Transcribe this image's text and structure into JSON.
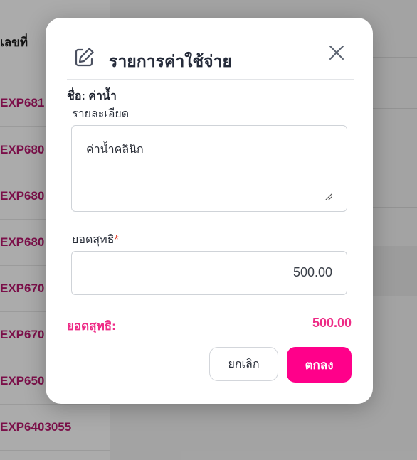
{
  "background": {
    "column_header": "เลขที่",
    "rows": [
      "EXP681",
      "EXP680",
      "EXP680",
      "EXP680",
      "EXP670",
      "EXP670",
      "EXP650",
      "EXP6403055"
    ]
  },
  "modal": {
    "title": "รายการค่าใช้จ่าย",
    "name_line": "ชื่อ: ค่าน้ำ",
    "detail_label": "รายละเอียด",
    "detail_value": "ค่าน้ำคลินิก",
    "net_label": "ยอดสุทธิ",
    "required_mark": "*",
    "net_value": "500.00",
    "summary_label": "ยอดสุทธิ:",
    "summary_value": "500.00",
    "cancel_label": "ยกเลิก",
    "ok_label": "ตกลง",
    "icons": {
      "header": "edit-icon",
      "close": "close-icon",
      "resize": "resize-handle-icon"
    }
  },
  "colors": {
    "accent": "#ff008a",
    "summary": "#ee2a86",
    "required": "#e0321c",
    "row_id": "#b8176d"
  }
}
